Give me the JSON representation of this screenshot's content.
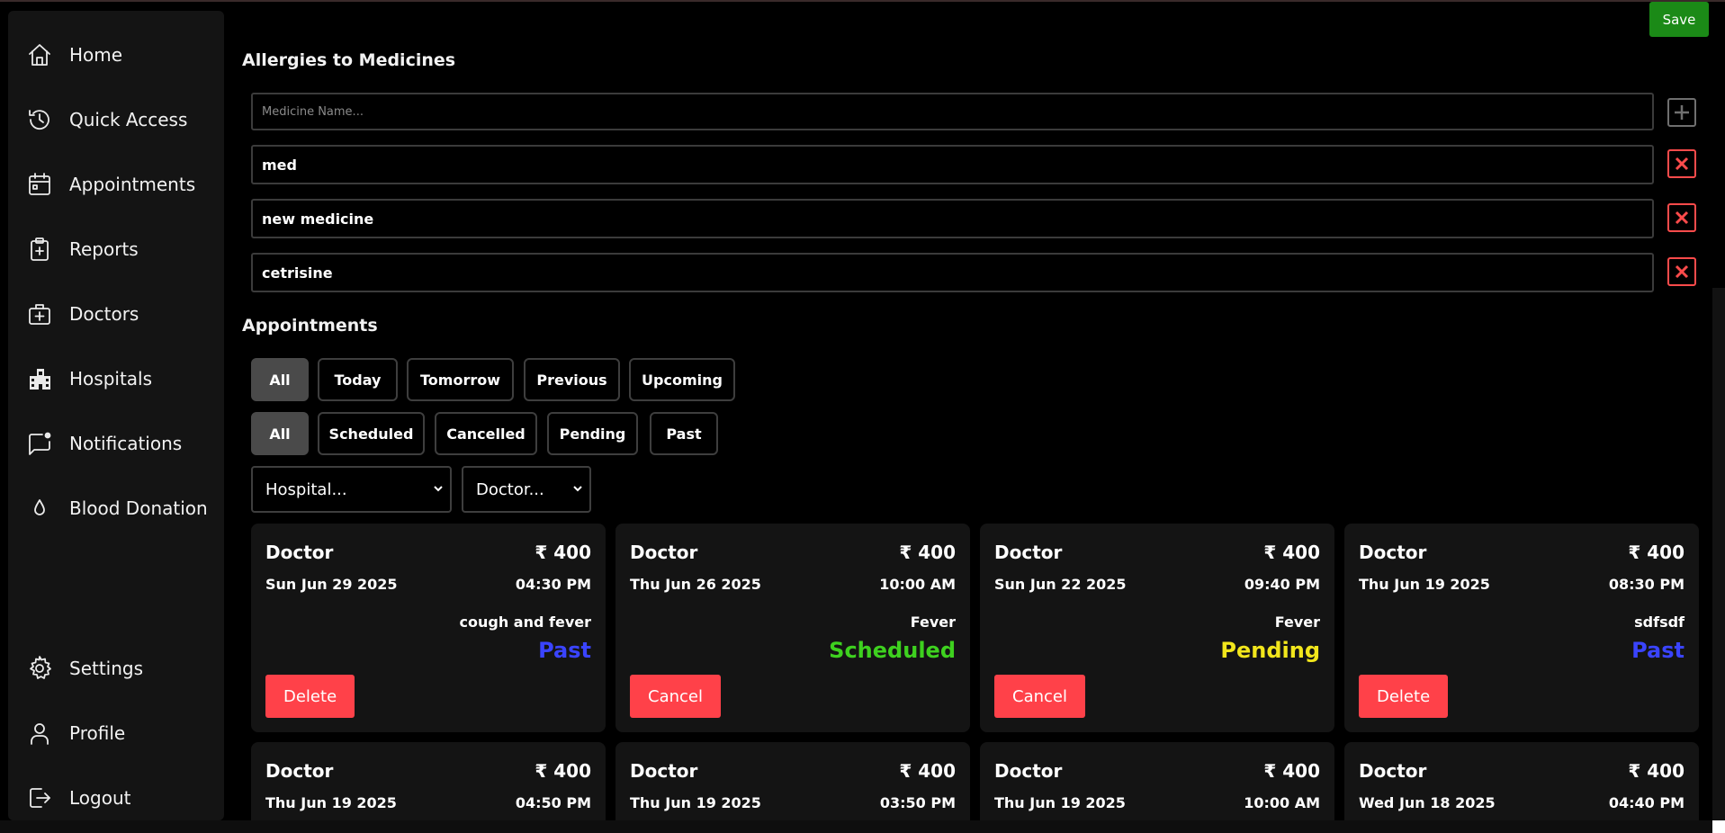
{
  "sidebar": {
    "top_items": [
      {
        "label": "Home",
        "icon": "home-icon"
      },
      {
        "label": "Quick Access",
        "icon": "history-icon"
      },
      {
        "label": "Appointments",
        "icon": "calendar-icon"
      },
      {
        "label": "Reports",
        "icon": "clipboard-plus-icon"
      },
      {
        "label": "Doctors",
        "icon": "medical-bag-icon"
      },
      {
        "label": "Hospitals",
        "icon": "hospital-building-icon"
      },
      {
        "label": "Notifications",
        "icon": "message-badge-icon"
      },
      {
        "label": "Blood Donation",
        "icon": "blood-drop-icon"
      }
    ],
    "bottom_items": [
      {
        "label": "Settings",
        "icon": "gear-icon"
      },
      {
        "label": "Profile",
        "icon": "user-icon"
      },
      {
        "label": "Logout",
        "icon": "logout-icon"
      }
    ]
  },
  "header": {
    "save_label": "Save"
  },
  "allergies": {
    "title": "Allergies to Medicines",
    "placeholder": "Medicine Name...",
    "items": [
      "med",
      "new medicine",
      "cetrisine"
    ]
  },
  "appointments": {
    "title": "Appointments",
    "date_filters": [
      "All",
      "Today",
      "Tomorrow",
      "Previous",
      "Upcoming"
    ],
    "status_filters": [
      "All",
      "Scheduled",
      "Cancelled",
      "Pending",
      "Past"
    ],
    "active_date_filter": "All",
    "active_status_filter": "All",
    "hospital_select": "Hospital...",
    "doctor_select": "Doctor...",
    "cards": [
      {
        "doctor": "Doctor",
        "fee": "₹ 400",
        "date": "Sun Jun 29 2025",
        "time": "04:30 PM",
        "reason": "cough and fever",
        "status": "Past",
        "action": "Delete"
      },
      {
        "doctor": "Doctor",
        "fee": "₹ 400",
        "date": "Thu Jun 26 2025",
        "time": "10:00 AM",
        "reason": "Fever",
        "status": "Scheduled",
        "action": "Cancel"
      },
      {
        "doctor": "Doctor",
        "fee": "₹ 400",
        "date": "Sun Jun 22 2025",
        "time": "09:40 PM",
        "reason": "Fever",
        "status": "Pending",
        "action": "Cancel"
      },
      {
        "doctor": "Doctor",
        "fee": "₹ 400",
        "date": "Thu Jun 19 2025",
        "time": "08:30 PM",
        "reason": "sdfsdf",
        "status": "Past",
        "action": "Delete"
      },
      {
        "doctor": "Doctor",
        "fee": "₹ 400",
        "date": "Thu Jun 19 2025",
        "time": "04:50 PM"
      },
      {
        "doctor": "Doctor",
        "fee": "₹ 400",
        "date": "Thu Jun 19 2025",
        "time": "03:50 PM"
      },
      {
        "doctor": "Doctor",
        "fee": "₹ 400",
        "date": "Thu Jun 19 2025",
        "time": "10:00 AM"
      },
      {
        "doctor": "Doctor",
        "fee": "₹ 400",
        "date": "Wed Jun 18 2025",
        "time": "04:40 PM"
      }
    ],
    "status_colors": {
      "Past": "#3a44ff",
      "Scheduled": "#3ed11f",
      "Pending": "#f2e61c"
    }
  },
  "colors": {
    "save": "#1b8a17",
    "danger": "#ff4149",
    "card_bg": "#141414"
  }
}
